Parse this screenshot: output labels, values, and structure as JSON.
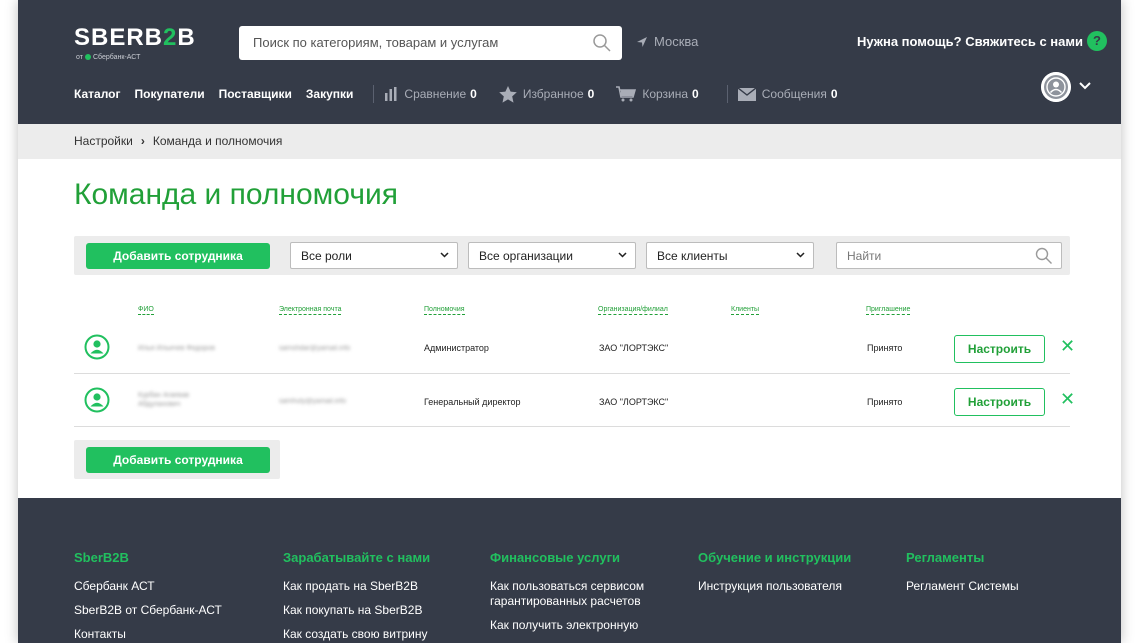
{
  "header": {
    "logo_main": "SBERB",
    "logo_accent": "2",
    "logo_end": "B",
    "logo_sub_left": "от",
    "logo_sub_right": "Сбербанк-АСТ",
    "search_placeholder": "Поиск по категориям, товарам и услугам",
    "city": "Москва",
    "help": "Нужна помощь? Свяжитесь с нами",
    "help_icon": "?",
    "nav": [
      "Каталог",
      "Покупатели",
      "Поставщики",
      "Закупки"
    ],
    "tools": [
      {
        "label": "Сравнение",
        "count": "0",
        "icon": "compare-icon"
      },
      {
        "label": "Избранное",
        "count": "0",
        "icon": "star-icon"
      },
      {
        "label": "Корзина",
        "count": "0",
        "icon": "cart-icon"
      },
      {
        "label": "Сообщения",
        "count": "0",
        "icon": "mail-icon"
      }
    ]
  },
  "breadcrumb": {
    "parent": "Настройки",
    "sep": "›",
    "current": "Команда и полномочия"
  },
  "page_title": "Команда и полномочия",
  "filters": {
    "add_label": "Добавить сотрудника",
    "roles": "Все роли",
    "orgs": "Все организации",
    "clients": "Все клиенты",
    "find_placeholder": "Найти"
  },
  "table": {
    "headers": [
      "ФИО",
      "Электронная почта",
      "Полномочия",
      "Организация/филиал",
      "Клиенты",
      "Приглашение"
    ],
    "rows": [
      {
        "name": "Илья Ильичев Федоров",
        "email": "samshdar@yamail.info",
        "role": "Администратор",
        "org": "ЗАО \"ЛОРТЭКС\"",
        "clients": "",
        "invite": "Принято",
        "action": "Настроить",
        "delete": "✕"
      },
      {
        "name": "Курбан Агаевав Абдулахович",
        "email": "samhuty@yamail.info",
        "role": "Генеральный директор",
        "org": "ЗАО \"ЛОРТЭКС\"",
        "clients": "",
        "invite": "Принято",
        "action": "Настроить",
        "delete": "✕"
      }
    ]
  },
  "add_bottom_label": "Добавить сотрудника",
  "footer": {
    "columns": [
      {
        "title": "SberB2B",
        "links": [
          "Сбербанк АСТ",
          "SberB2B от Сбербанк-АСТ",
          "Контакты"
        ]
      },
      {
        "title": "Зарабатывайте с нами",
        "links": [
          "Как продать на SberB2B",
          "Как покупать на SberB2B",
          "Как создать свою витрину"
        ]
      },
      {
        "title": "Финансовые услуги",
        "links": [
          "Как пользоваться сервисом гарантированных расчетов",
          "Как получить электронную"
        ]
      },
      {
        "title": "Обучение и инструкции",
        "links": [
          "Инструкция пользователя"
        ]
      },
      {
        "title": "Регламенты",
        "links": [
          "Регламент Системы"
        ]
      }
    ]
  },
  "colors": {
    "brand_green": "#21c05f",
    "header_bg": "#353b48",
    "title_green": "#21a038"
  }
}
